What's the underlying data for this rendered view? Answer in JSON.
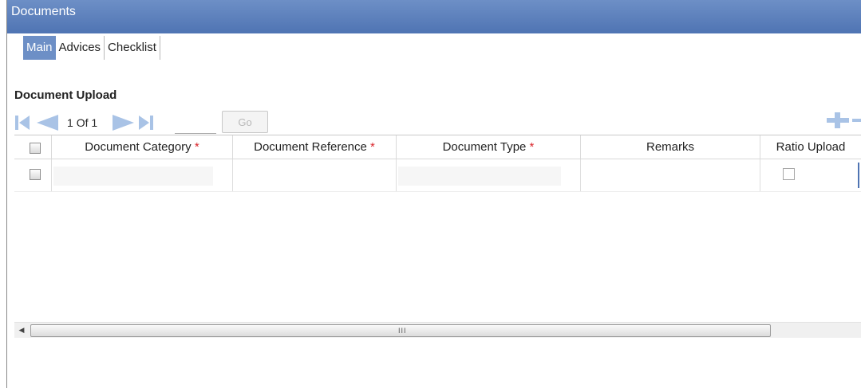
{
  "window": {
    "title": "Documents"
  },
  "tabs": [
    {
      "label": "Main",
      "active": true
    },
    {
      "label": "Advices",
      "active": false
    },
    {
      "label": "Checklist",
      "active": false
    }
  ],
  "section": {
    "title": "Document Upload"
  },
  "pager": {
    "current": 1,
    "of_label": "Of",
    "total": 1,
    "go_label": "Go",
    "goto_value": ""
  },
  "grid": {
    "columns": [
      {
        "label": "Document Category",
        "required": true
      },
      {
        "label": "Document Reference",
        "required": true
      },
      {
        "label": "Document Type",
        "required": true
      },
      {
        "label": "Remarks",
        "required": false
      },
      {
        "label": "Ratio Upload",
        "required": false
      }
    ],
    "required_marker": "*",
    "rows": [
      {
        "document_category": "",
        "document_reference": "",
        "document_type": "",
        "remarks": "",
        "ratio_upload": false
      }
    ]
  },
  "scrollbar": {
    "grip": "III"
  },
  "colors": {
    "title_bar": "#5579b8",
    "active_tab": "#6d8fc6",
    "required": "#d9252b",
    "nav_icon": "#a9c3e6"
  }
}
